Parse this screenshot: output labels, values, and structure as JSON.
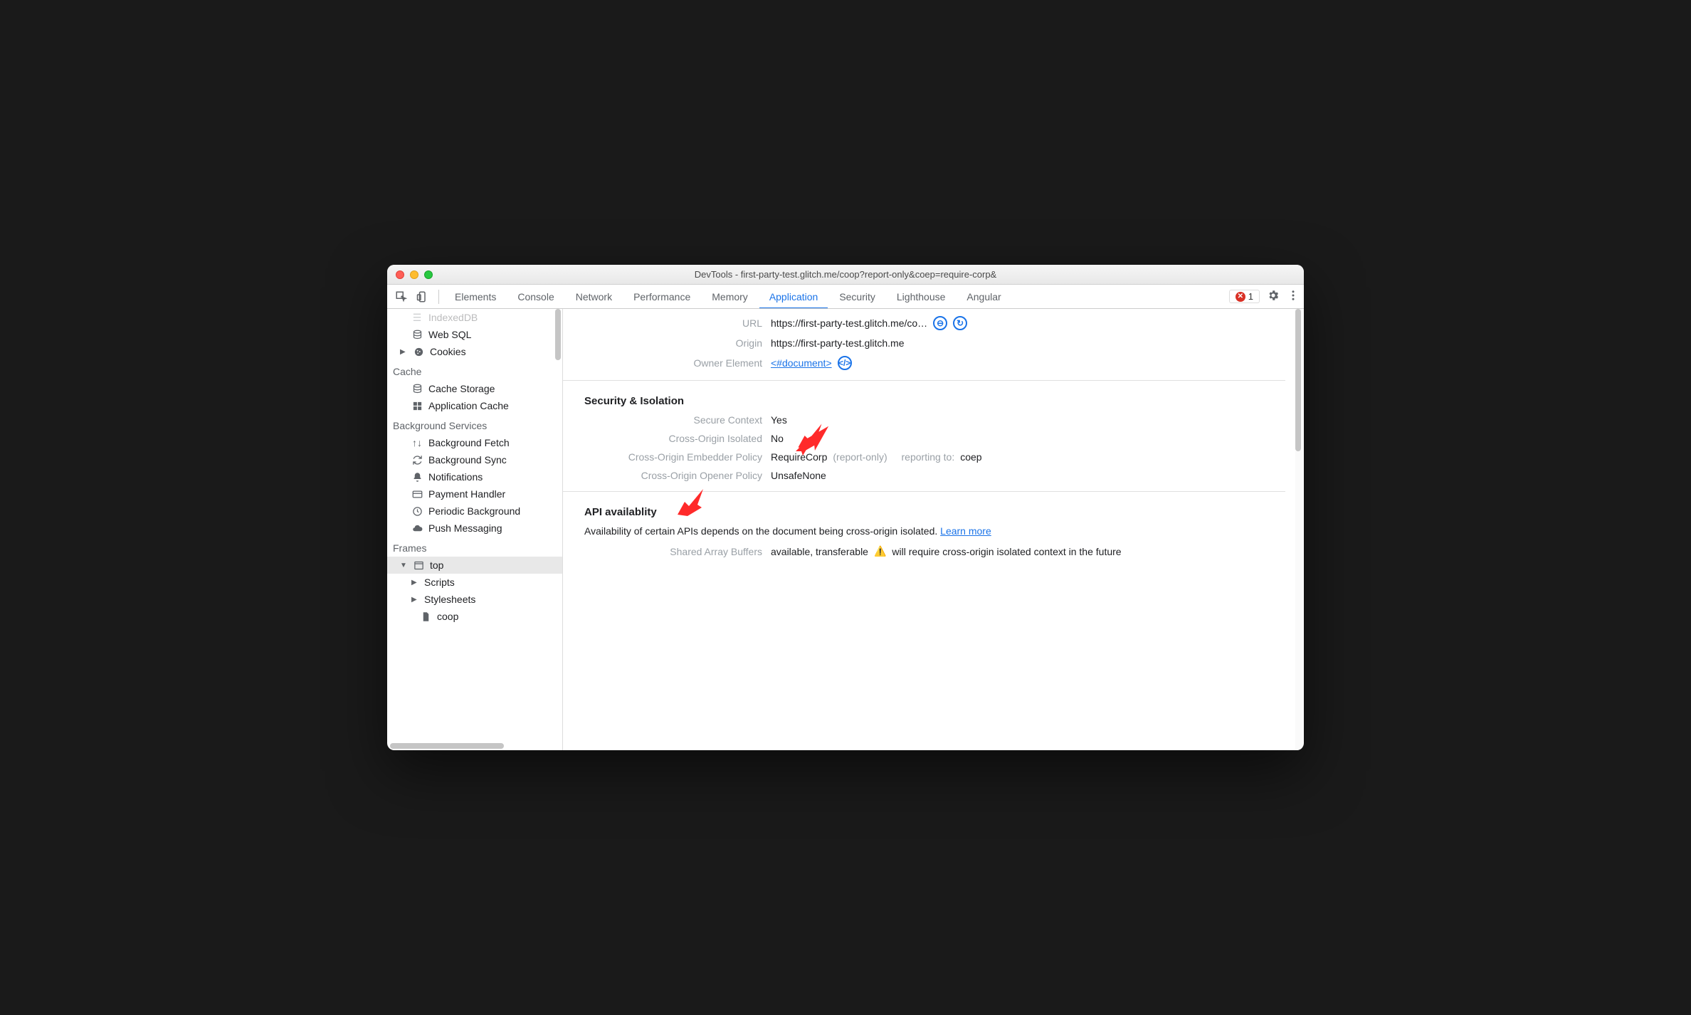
{
  "window": {
    "title": "DevTools - first-party-test.glitch.me/coop?report-only&coep=require-corp&"
  },
  "tabs": {
    "t0": "Elements",
    "t1": "Console",
    "t2": "Network",
    "t3": "Performance",
    "t4": "Memory",
    "t5": "Application",
    "t6": "Security",
    "t7": "Lighthouse",
    "t8": "Angular"
  },
  "errors": {
    "count": "1"
  },
  "sidebar": {
    "indexeddb": "IndexedDB",
    "websql": "Web SQL",
    "cookies": "Cookies",
    "cache_group": "Cache",
    "cache_storage": "Cache Storage",
    "app_cache": "Application Cache",
    "bg_group": "Background Services",
    "bg_fetch": "Background Fetch",
    "bg_sync": "Background Sync",
    "notifications": "Notifications",
    "payment": "Payment Handler",
    "periodic": "Periodic Background",
    "push": "Push Messaging",
    "frames_group": "Frames",
    "top": "top",
    "scripts": "Scripts",
    "stylesheets": "Stylesheets",
    "coop": "coop"
  },
  "content": {
    "url_label": "URL",
    "url_value": "https://first-party-test.glitch.me/co…",
    "origin_label": "Origin",
    "origin_value": "https://first-party-test.glitch.me",
    "owner_label": "Owner Element",
    "owner_value": "<#document>",
    "sec_title": "Security & Isolation",
    "secure_ctx_label": "Secure Context",
    "secure_ctx_value": "Yes",
    "coi_label": "Cross-Origin Isolated",
    "coi_value": "No",
    "coep_label": "Cross-Origin Embedder Policy",
    "coep_value": "RequireCorp",
    "coep_note1": "(report-only)",
    "coep_note2": "reporting to:",
    "coep_note3": "coep",
    "coop_label": "Cross-Origin Opener Policy",
    "coop_value": "UnsafeNone",
    "api_title": "API availablity",
    "api_desc": "Availability of certain APIs depends on the document being cross-origin isolated. ",
    "learn_more": "Learn more",
    "sab_label": "Shared Array Buffers",
    "sab_value": "available, transferable",
    "sab_warn": "will require cross-origin isolated context in the future"
  }
}
